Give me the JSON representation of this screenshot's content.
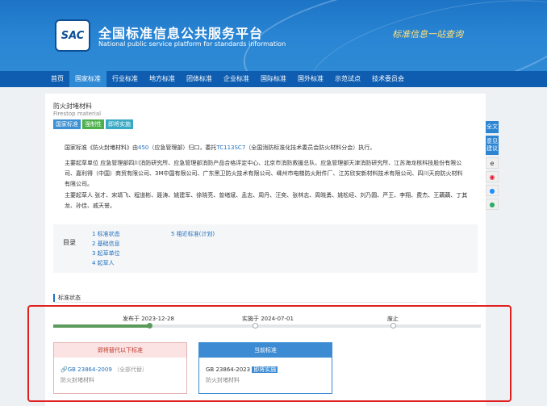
{
  "header": {
    "logo_text": "SAC",
    "title": "全国标准信息公共服务平台",
    "subtitle": "National public service platform  for standards information",
    "slogan": "标准信息一站查询"
  },
  "nav": {
    "items": [
      "首页",
      "国家标准",
      "行业标准",
      "地方标准",
      "团体标准",
      "企业标准",
      "国际标准",
      "国外标准",
      "示范试点",
      "技术委员会"
    ],
    "active_index": 1
  },
  "standard": {
    "title": "防火封堵材料",
    "title_en": "Firestop material",
    "badges": [
      "国家标准",
      "强制性",
      "即将实施"
    ],
    "desc_prefix": "国家标准《防火封堵材料》由",
    "desc_org_code": "450",
    "desc_mid": "（应急管理部）归口，委托",
    "desc_tc": "TC113SC7",
    "desc_suffix": "（全国消防标准化技术委员会防火材料分会）执行。",
    "drafting_units": "主要起草单位 应急管理部四川消防研究所、应急管理部消防产品合格评定中心、北京市消防救援总队、应急管理部天津消防研究所、江苏海龙核科技股份有限公司、嘉利得（中国）商贸有限公司、3M中国有限公司、广东黑卫防火技术有限公司、嵊州市电梯防火附件厂、江苏欣安新材料技术有限公司、四川天府防火材料有限公司。",
    "drafters": "主要起草人 张才、宋靖飞、程道彬、聂涛、姚建军、徐晓亮、曾绪斌、孟志、周丹、汪奕、张林志、周晓勇、姚松经、刘乃圆、严王、李翔、费杰、王藕藕、丁其龙、孙佳、戚天誉。"
  },
  "toc": {
    "label": "目录",
    "col1": [
      "1  标准状态",
      "2  基础信息",
      "3  起草单位",
      "4  起草人"
    ],
    "col2": [
      "5  相近标准(计划)"
    ]
  },
  "status_section": {
    "title": "标准状态",
    "published": "发布于 2023-12-28",
    "implemented": "实施于 2024-07-01",
    "abolished": "废止",
    "progress": 0.25
  },
  "replaced_box": {
    "header": "即将替代以下标准",
    "code": "GB 23864-2009",
    "note": "（全部代替）",
    "name": "防火封堵材料"
  },
  "current_box": {
    "header": "当前标准",
    "code": "GB 23864-2023",
    "tag": "即将实施",
    "name": "防火封堵材料"
  },
  "float_bar": {
    "fulltext": "全文",
    "feedback": "意见建议"
  },
  "colors": {
    "header_blue": "#1d74c6",
    "nav_blue": "#0e5db0",
    "link_blue": "#1e6fc0",
    "highlight_red": "#e02020"
  }
}
